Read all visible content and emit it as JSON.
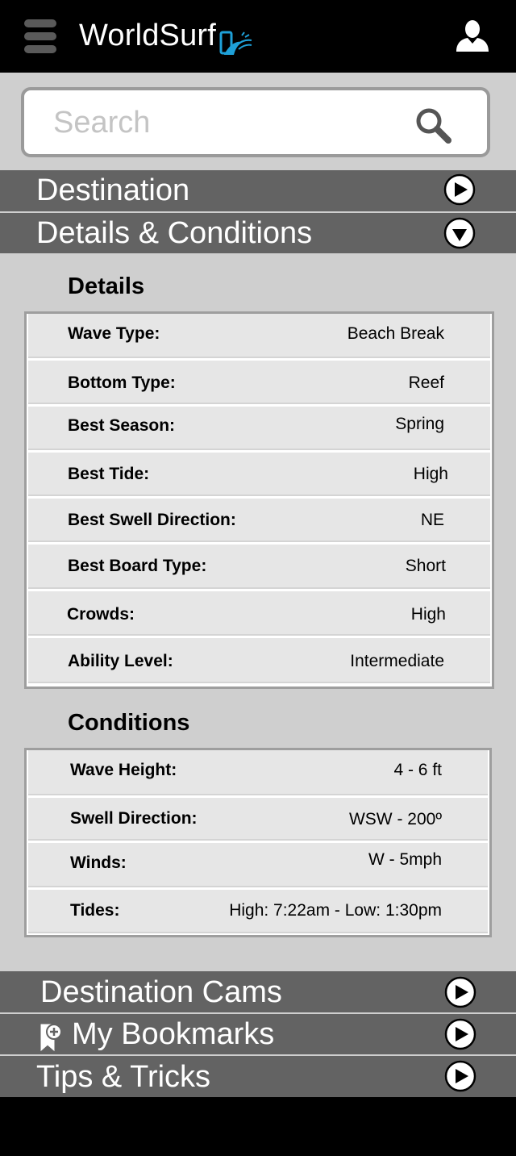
{
  "header": {
    "logo_text": "WorldSurf",
    "menu_icon": "hamburger-menu-icon",
    "logo_icon": "phone-wave-icon",
    "user_icon": "user-icon"
  },
  "search": {
    "placeholder": "Search",
    "icon": "search-icon"
  },
  "accordion": {
    "destination": {
      "label": "Destination",
      "state": "collapsed"
    },
    "details_conditions": {
      "label": "Details & Conditions",
      "state": "expanded"
    },
    "destination_cams": {
      "label": "Destination Cams",
      "state": "collapsed"
    },
    "my_bookmarks": {
      "label": "My Bookmarks",
      "state": "collapsed",
      "icon": "bookmark-add-icon"
    },
    "tips_tricks": {
      "label": "Tips & Tricks",
      "state": "collapsed"
    }
  },
  "details": {
    "title": "Details",
    "rows": [
      {
        "label": "Wave Type:",
        "value": "Beach Break"
      },
      {
        "label": "Bottom Type:",
        "value": "Reef"
      },
      {
        "label": "Best Season:",
        "value": "Spring"
      },
      {
        "label": "Best Tide:",
        "value": "High"
      },
      {
        "label": "Best Swell Direction:",
        "value": "NE"
      },
      {
        "label": "Best Board Type:",
        "value": "Short"
      },
      {
        "label": "Crowds:",
        "value": "High"
      },
      {
        "label": "Ability Level:",
        "value": "Intermediate"
      }
    ]
  },
  "conditions": {
    "title": "Conditions",
    "rows": [
      {
        "label": "Wave Height:",
        "value": "4 - 6 ft"
      },
      {
        "label": "Swell Direction:",
        "value": "WSW - 200º"
      },
      {
        "label": "Winds:",
        "value": "W - 5mph"
      },
      {
        "label": "Tides:",
        "value": "High: 7:22am - Low: 1:30pm"
      }
    ]
  },
  "colors": {
    "header_bg": "#000000",
    "page_bg": "#cfcfcf",
    "accordion_bg": "#636363",
    "row_bg": "#e6e6e6",
    "logo_accent": "#1ea0d8"
  }
}
